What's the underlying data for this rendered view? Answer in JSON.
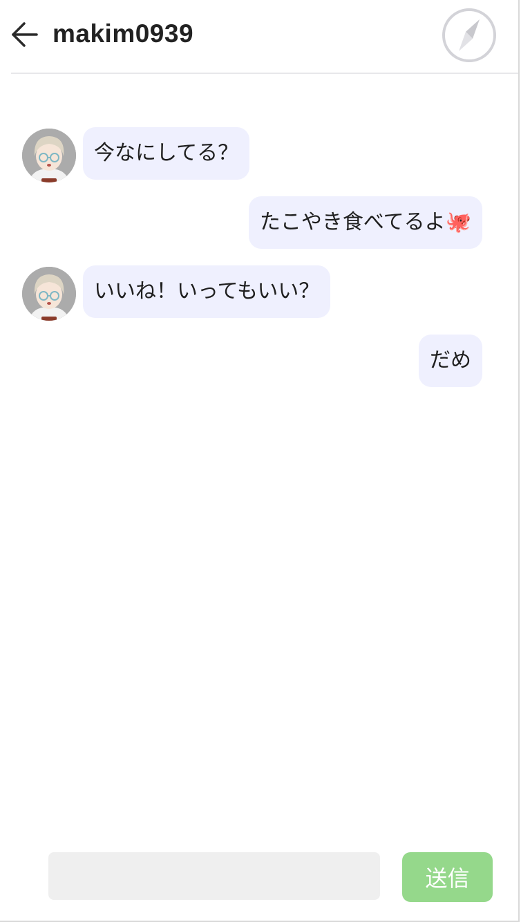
{
  "header": {
    "title": "makim0939",
    "back_icon": "arrow-left-icon",
    "nav_icon": "compass-icon"
  },
  "messages": [
    {
      "side": "received",
      "text": "今なにしてる？"
    },
    {
      "side": "sent",
      "text": "たこやき食べてるよ🐙"
    },
    {
      "side": "received",
      "text": "いいね！いってもいい？"
    },
    {
      "side": "sent",
      "text": "だめ"
    }
  ],
  "composer": {
    "value": "",
    "placeholder": "",
    "send_label": "送信"
  },
  "colors": {
    "bubble": "#eff0fe",
    "send_button": "#95d88b",
    "title": "#222222"
  }
}
